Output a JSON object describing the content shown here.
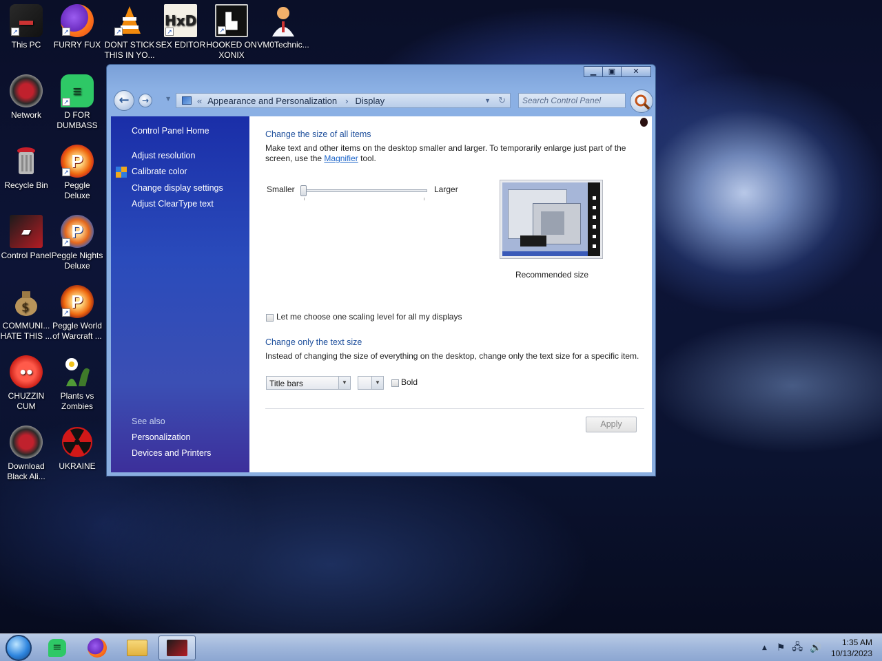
{
  "desktop": {
    "icons": [
      {
        "label": "This PC",
        "icon": "computer-icon"
      },
      {
        "label": "FURRY FUX",
        "icon": "firefox-icon"
      },
      {
        "label": "DONT STICK THIS IN YO...",
        "icon": "vlc-cone-icon"
      },
      {
        "label": "SEX EDITOR",
        "icon": "hxd-icon"
      },
      {
        "label": "HOOKED ON XONIX",
        "icon": "xonix-icon"
      },
      {
        "label": "VM0Technic...",
        "icon": "doctor-icon"
      },
      {
        "label": "Network",
        "icon": "network-icon"
      },
      {
        "label": "D FOR DUMBASS",
        "icon": "green-chat-icon"
      },
      {
        "label": "Recycle Bin",
        "icon": "recycle-bin-icon"
      },
      {
        "label": "Peggle Deluxe",
        "icon": "peggle-icon"
      },
      {
        "label": "Control Panel",
        "icon": "control-panel-icon"
      },
      {
        "label": "Peggle Nights Deluxe",
        "icon": "peggle-nights-icon"
      },
      {
        "label": "COMMUNI... HATE THIS ...",
        "icon": "money-bag-icon"
      },
      {
        "label": "Peggle World of Warcraft ...",
        "icon": "peggle-wow-icon"
      },
      {
        "label": "CHUZZIN CUM",
        "icon": "chuzzle-icon"
      },
      {
        "label": "Plants vs Zombies",
        "icon": "plants-vs-zombies-icon"
      },
      {
        "label": "Download Black Ali...",
        "icon": "download-icon"
      },
      {
        "label": "UKRAINE",
        "icon": "radiation-icon"
      }
    ]
  },
  "window": {
    "controls": {
      "minimize": "▁",
      "maximize": "▣",
      "close": "✕"
    },
    "breadcrumb": {
      "root": "Appearance and Personalization",
      "current": "Display"
    },
    "search_placeholder": "Search Control Panel",
    "sidebar": {
      "home": "Control Panel Home",
      "links": [
        "Adjust resolution",
        "Calibrate color",
        "Change display settings",
        "Adjust ClearType text"
      ],
      "see_also_title": "See also",
      "see_also": [
        "Personalization",
        "Devices and Printers"
      ]
    },
    "content": {
      "heading1": "Change the size of all items",
      "desc1_part1": "Make text and other items on the desktop smaller and larger. To temporarily enlarge just part of the screen, use the",
      "magnifier_link": "Magnifier",
      "desc1_part2": "tool.",
      "slider_min_label": "Smaller",
      "slider_max_label": "Larger",
      "slider_level": 0,
      "preview_caption": "Recommended size",
      "scaling_checkbox_label": "Let me choose one scaling level for all my displays",
      "heading2": "Change only the text size",
      "desc2": "Instead of changing the size of everything on the desktop, change only the text size for a specific item.",
      "item_select_value": "Title bars",
      "size_select_value": "",
      "bold_label": "Bold",
      "apply_button": "Apply"
    }
  },
  "taskbar": {
    "items": [
      "start-orb-icon",
      "green-chat-icon",
      "firefox-icon",
      "file-explorer-icon",
      "control-panel-icon"
    ],
    "clock_time": "1:35 AM",
    "clock_date": "10/13/2023"
  }
}
